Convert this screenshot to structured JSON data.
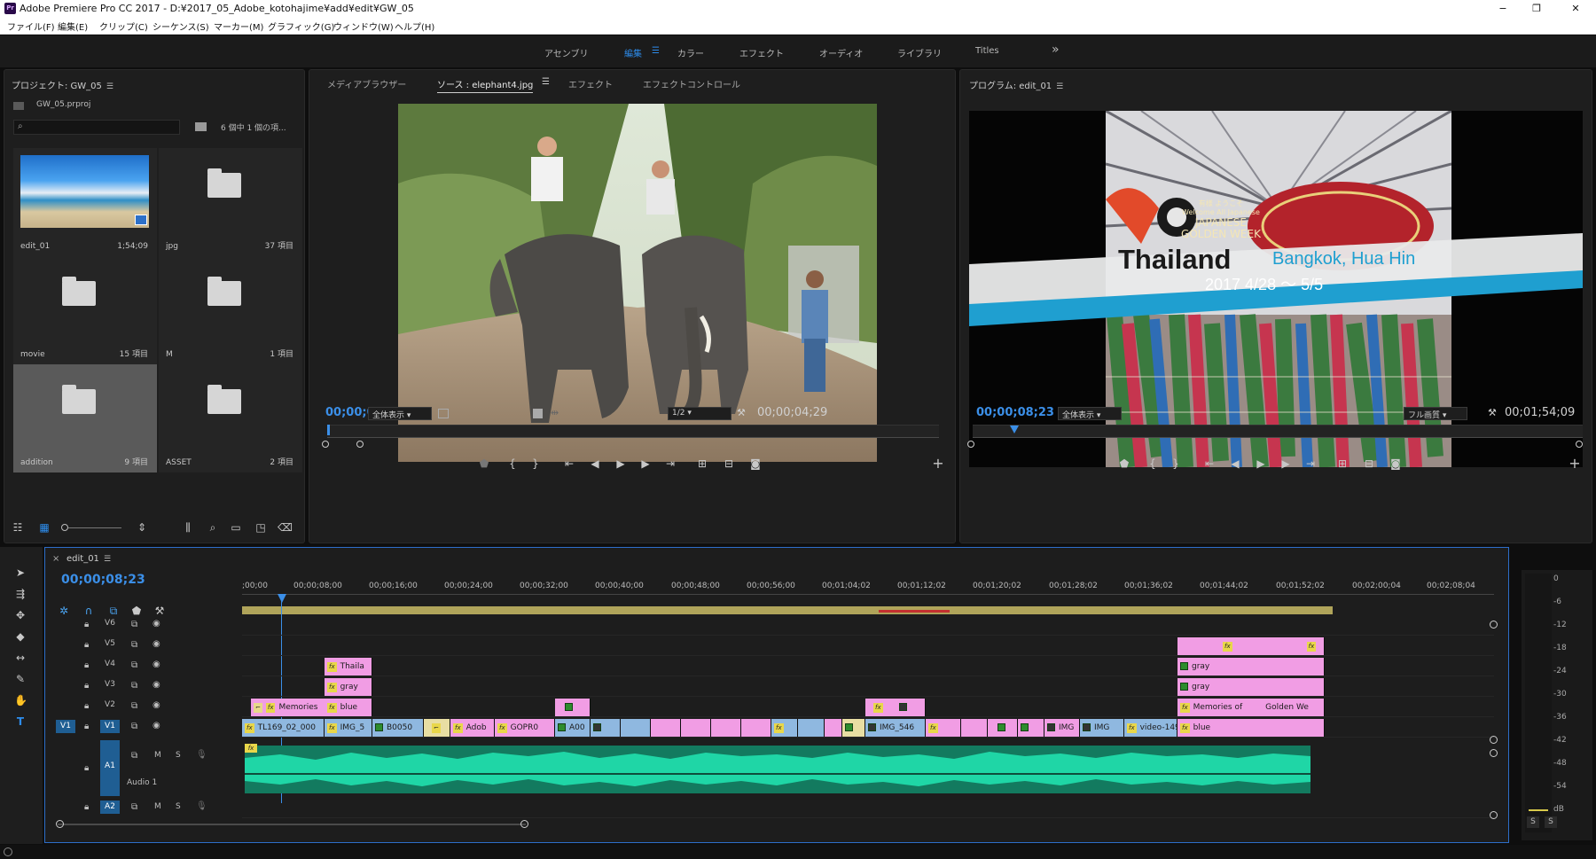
{
  "app": {
    "title": "Adobe Premiere Pro CC 2017 - D:¥2017_05_Adobe_kotohajime¥add¥edit¥GW_05",
    "logo": "Pr",
    "window_controls": [
      "−",
      "❐",
      "✕"
    ]
  },
  "menu": [
    "ファイル(F)",
    "編集(E)",
    "クリップ(C)",
    "シーケンス(S)",
    "マーカー(M)",
    "グラフィック(G)",
    "ウィンドウ(W)",
    "ヘルプ(H)"
  ],
  "workspaces": {
    "items": [
      "アセンブリ",
      "編集",
      "カラー",
      "エフェクト",
      "オーディオ",
      "ライブラリ",
      "Titles"
    ],
    "active": "編集",
    "more": "»"
  },
  "project": {
    "header": "プロジェクト: GW_05",
    "file": "GW_05.prproj",
    "search_placeholder": "",
    "count": "6 個中 1 個の項...",
    "bins": [
      {
        "name": "edit_01",
        "count": "1;54;09",
        "thumb": "sequence"
      },
      {
        "name": "jpg",
        "count": "37 項目",
        "thumb": "folder"
      },
      {
        "name": "movie",
        "count": "15 項目",
        "thumb": "folder"
      },
      {
        "name": "M",
        "count": "1 項目",
        "thumb": "folder"
      },
      {
        "name": "addition",
        "count": "9 項目",
        "thumb": "folder"
      },
      {
        "name": "ASSET",
        "count": "2 項目",
        "thumb": "folder"
      }
    ]
  },
  "source": {
    "tabs": [
      "メディアブラウザー",
      "ソース : elephant4.jpg",
      "エフェクト",
      "エフェクトコントロール"
    ],
    "active_tab": "ソース : elephant4.jpg",
    "timecode": "00;00;00;00",
    "duration": "00;00;04;29",
    "zoom": "全体表示",
    "resolution": "1/2"
  },
  "program": {
    "header": "プログラム: edit_01",
    "timecode": "00;00;08;23",
    "duration": "00;01;54;09",
    "zoom": "全体表示",
    "quality": "フル画質",
    "title_main": "Thailand",
    "title_sub": "Bangkok, Hua Hin",
    "title_date": "2017 4/28 ～ 5/5",
    "sign_lines": [
      "有様 ようこそ",
      "Welcome All Japanese",
      "JAPANESE",
      "GOLDEN WEEK"
    ]
  },
  "timeline": {
    "sequence": "edit_01",
    "timecode": "00;00;08;23",
    "ruler": [
      ";00;00",
      "00;00;08;00",
      "00;00;16;00",
      "00;00;24;00",
      "00;00;32;00",
      "00;00;40;00",
      "00;00;48;00",
      "00;00;56;00",
      "00;01;04;02",
      "00;01;12;02",
      "00;01;20;02",
      "00;01;28;02",
      "00;01;36;02",
      "00;01;44;02",
      "00;01;52;02",
      "00;02;00;04",
      "00;02;08;04"
    ],
    "video_tracks": [
      "V6",
      "V5",
      "V4",
      "V3",
      "V2",
      "V1"
    ],
    "audio_tracks": [
      "A1",
      "A2"
    ],
    "source_patch": "V1",
    "audio_label": "Audio 1",
    "clips": {
      "v4": [
        "Thaila"
      ],
      "v3": [
        "gray"
      ],
      "v2": [
        "Memories",
        "blue"
      ],
      "v1": [
        "TL169_02_000",
        "IMG_5",
        "B0050",
        "Adob",
        "GOPR0",
        "A00",
        "IMG_546",
        "IMG",
        "IMG",
        "video-149",
        "blue"
      ],
      "right_v5": "",
      "right_v4": "gray",
      "right_v3": "gray",
      "right_v2a": "Memories of",
      "right_v2b": "Golden We"
    }
  },
  "meter": {
    "scale": [
      "0",
      "-6",
      "-12",
      "-18",
      "-24",
      "-30",
      "-36",
      "-42",
      "-48",
      "-54",
      "dB"
    ],
    "solo": [
      "S",
      "S"
    ]
  },
  "colors": {
    "accent": "#2d8ceb",
    "clip_pink": "#f19de4",
    "clip_blue": "#8fb8e0",
    "audio": "#1fd6a6",
    "work_area": "#b0a45a"
  }
}
